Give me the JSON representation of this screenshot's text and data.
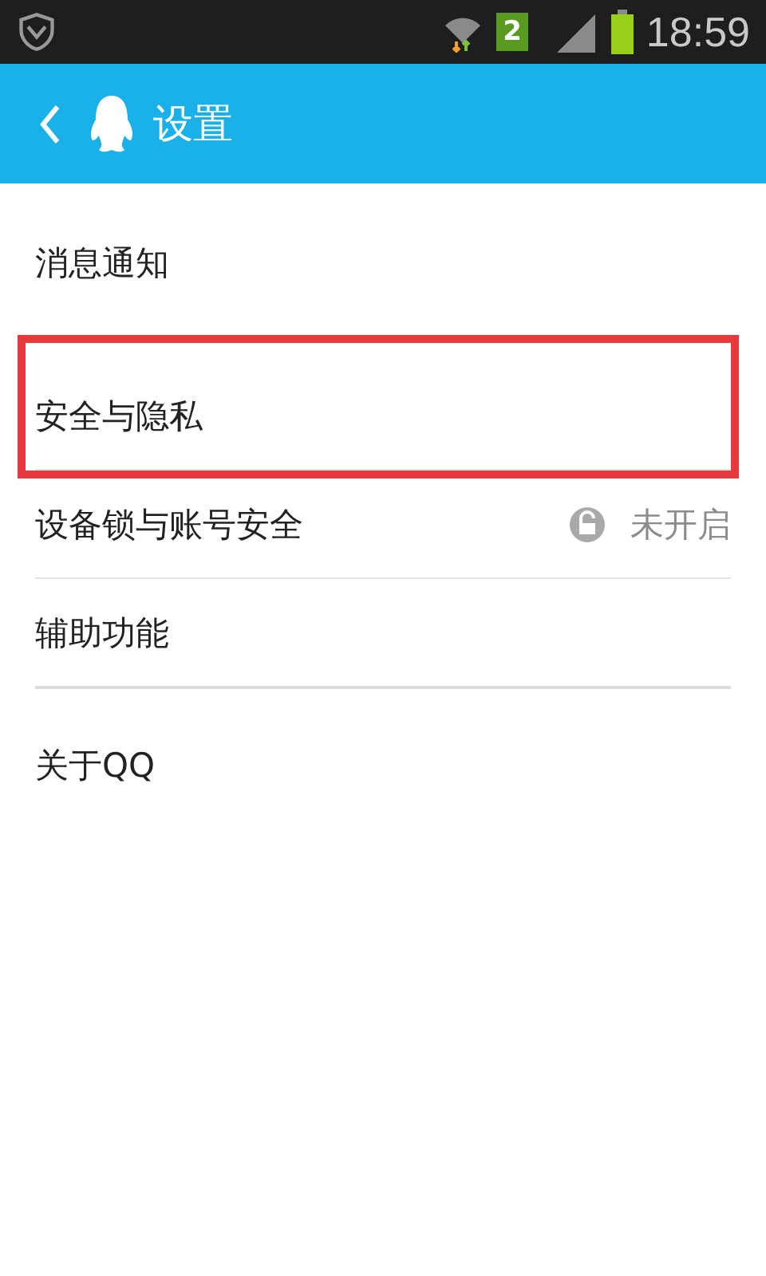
{
  "status_bar": {
    "sim_badge": "2",
    "time": "18:59"
  },
  "header": {
    "title": "设置"
  },
  "sections": [
    {
      "items": [
        {
          "label": "消息通知",
          "highlighted": false
        }
      ]
    },
    {
      "items": [
        {
          "label": "安全与隐私",
          "highlighted": true
        },
        {
          "label": "设备锁与账号安全",
          "value": "未开启",
          "highlighted": false
        },
        {
          "label": "辅助功能",
          "highlighted": false
        }
      ]
    },
    {
      "items": [
        {
          "label": "关于QQ",
          "highlighted": false
        }
      ]
    }
  ]
}
